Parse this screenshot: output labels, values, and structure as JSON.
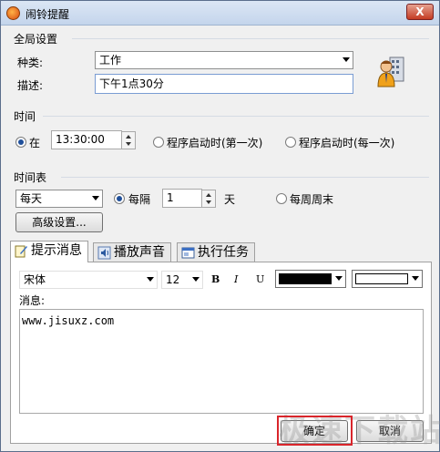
{
  "window": {
    "title": "闹铃提醒",
    "close_label": "X"
  },
  "global": {
    "section": "全局设置",
    "type_label": "种类:",
    "type_value": "工作",
    "desc_label": "描述:",
    "desc_value": "下午1点30分"
  },
  "time": {
    "section": "时间",
    "at_label": "在",
    "at_value": "13:30:00",
    "startup_first": "程序启动时(第一次)",
    "startup_each": "程序启动时(每一次)"
  },
  "schedule": {
    "section": "时间表",
    "freq_value": "每天",
    "interval_label": "每隔",
    "interval_value": "1",
    "unit_label": "天",
    "weekend_label": "每周周末",
    "advanced_label": "高级设置..."
  },
  "tabs": [
    {
      "label": "提示消息",
      "active": true
    },
    {
      "label": "播放声音",
      "active": false
    },
    {
      "label": "执行任务",
      "active": false
    }
  ],
  "message": {
    "font_value": "宋体",
    "size_value": "12",
    "bold": "B",
    "italic": "I",
    "underline": "U",
    "fore_color": "#000000",
    "back_color": "#ffffff",
    "msg_label": "消息:",
    "msg_text": "www.jisuxz.com"
  },
  "footer": {
    "ok_label": "确定",
    "cancel_label": "取消"
  },
  "watermark": "极速下载站"
}
